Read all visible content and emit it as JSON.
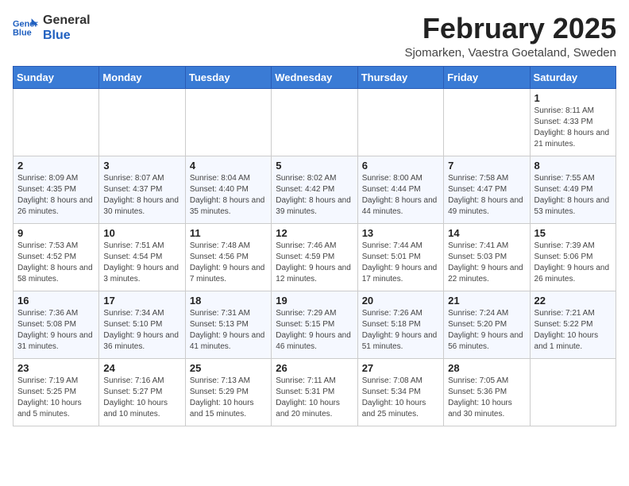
{
  "logo": {
    "line1": "General",
    "line2": "Blue"
  },
  "title": "February 2025",
  "subtitle": "Sjomarken, Vaestra Goetaland, Sweden",
  "weekdays": [
    "Sunday",
    "Monday",
    "Tuesday",
    "Wednesday",
    "Thursday",
    "Friday",
    "Saturday"
  ],
  "weeks": [
    [
      {
        "day": "",
        "detail": ""
      },
      {
        "day": "",
        "detail": ""
      },
      {
        "day": "",
        "detail": ""
      },
      {
        "day": "",
        "detail": ""
      },
      {
        "day": "",
        "detail": ""
      },
      {
        "day": "",
        "detail": ""
      },
      {
        "day": "1",
        "detail": "Sunrise: 8:11 AM\nSunset: 4:33 PM\nDaylight: 8 hours and 21 minutes."
      }
    ],
    [
      {
        "day": "2",
        "detail": "Sunrise: 8:09 AM\nSunset: 4:35 PM\nDaylight: 8 hours and 26 minutes."
      },
      {
        "day": "3",
        "detail": "Sunrise: 8:07 AM\nSunset: 4:37 PM\nDaylight: 8 hours and 30 minutes."
      },
      {
        "day": "4",
        "detail": "Sunrise: 8:04 AM\nSunset: 4:40 PM\nDaylight: 8 hours and 35 minutes."
      },
      {
        "day": "5",
        "detail": "Sunrise: 8:02 AM\nSunset: 4:42 PM\nDaylight: 8 hours and 39 minutes."
      },
      {
        "day": "6",
        "detail": "Sunrise: 8:00 AM\nSunset: 4:44 PM\nDaylight: 8 hours and 44 minutes."
      },
      {
        "day": "7",
        "detail": "Sunrise: 7:58 AM\nSunset: 4:47 PM\nDaylight: 8 hours and 49 minutes."
      },
      {
        "day": "8",
        "detail": "Sunrise: 7:55 AM\nSunset: 4:49 PM\nDaylight: 8 hours and 53 minutes."
      }
    ],
    [
      {
        "day": "9",
        "detail": "Sunrise: 7:53 AM\nSunset: 4:52 PM\nDaylight: 8 hours and 58 minutes."
      },
      {
        "day": "10",
        "detail": "Sunrise: 7:51 AM\nSunset: 4:54 PM\nDaylight: 9 hours and 3 minutes."
      },
      {
        "day": "11",
        "detail": "Sunrise: 7:48 AM\nSunset: 4:56 PM\nDaylight: 9 hours and 7 minutes."
      },
      {
        "day": "12",
        "detail": "Sunrise: 7:46 AM\nSunset: 4:59 PM\nDaylight: 9 hours and 12 minutes."
      },
      {
        "day": "13",
        "detail": "Sunrise: 7:44 AM\nSunset: 5:01 PM\nDaylight: 9 hours and 17 minutes."
      },
      {
        "day": "14",
        "detail": "Sunrise: 7:41 AM\nSunset: 5:03 PM\nDaylight: 9 hours and 22 minutes."
      },
      {
        "day": "15",
        "detail": "Sunrise: 7:39 AM\nSunset: 5:06 PM\nDaylight: 9 hours and 26 minutes."
      }
    ],
    [
      {
        "day": "16",
        "detail": "Sunrise: 7:36 AM\nSunset: 5:08 PM\nDaylight: 9 hours and 31 minutes."
      },
      {
        "day": "17",
        "detail": "Sunrise: 7:34 AM\nSunset: 5:10 PM\nDaylight: 9 hours and 36 minutes."
      },
      {
        "day": "18",
        "detail": "Sunrise: 7:31 AM\nSunset: 5:13 PM\nDaylight: 9 hours and 41 minutes."
      },
      {
        "day": "19",
        "detail": "Sunrise: 7:29 AM\nSunset: 5:15 PM\nDaylight: 9 hours and 46 minutes."
      },
      {
        "day": "20",
        "detail": "Sunrise: 7:26 AM\nSunset: 5:18 PM\nDaylight: 9 hours and 51 minutes."
      },
      {
        "day": "21",
        "detail": "Sunrise: 7:24 AM\nSunset: 5:20 PM\nDaylight: 9 hours and 56 minutes."
      },
      {
        "day": "22",
        "detail": "Sunrise: 7:21 AM\nSunset: 5:22 PM\nDaylight: 10 hours and 1 minute."
      }
    ],
    [
      {
        "day": "23",
        "detail": "Sunrise: 7:19 AM\nSunset: 5:25 PM\nDaylight: 10 hours and 5 minutes."
      },
      {
        "day": "24",
        "detail": "Sunrise: 7:16 AM\nSunset: 5:27 PM\nDaylight: 10 hours and 10 minutes."
      },
      {
        "day": "25",
        "detail": "Sunrise: 7:13 AM\nSunset: 5:29 PM\nDaylight: 10 hours and 15 minutes."
      },
      {
        "day": "26",
        "detail": "Sunrise: 7:11 AM\nSunset: 5:31 PM\nDaylight: 10 hours and 20 minutes."
      },
      {
        "day": "27",
        "detail": "Sunrise: 7:08 AM\nSunset: 5:34 PM\nDaylight: 10 hours and 25 minutes."
      },
      {
        "day": "28",
        "detail": "Sunrise: 7:05 AM\nSunset: 5:36 PM\nDaylight: 10 hours and 30 minutes."
      },
      {
        "day": "",
        "detail": ""
      }
    ]
  ]
}
